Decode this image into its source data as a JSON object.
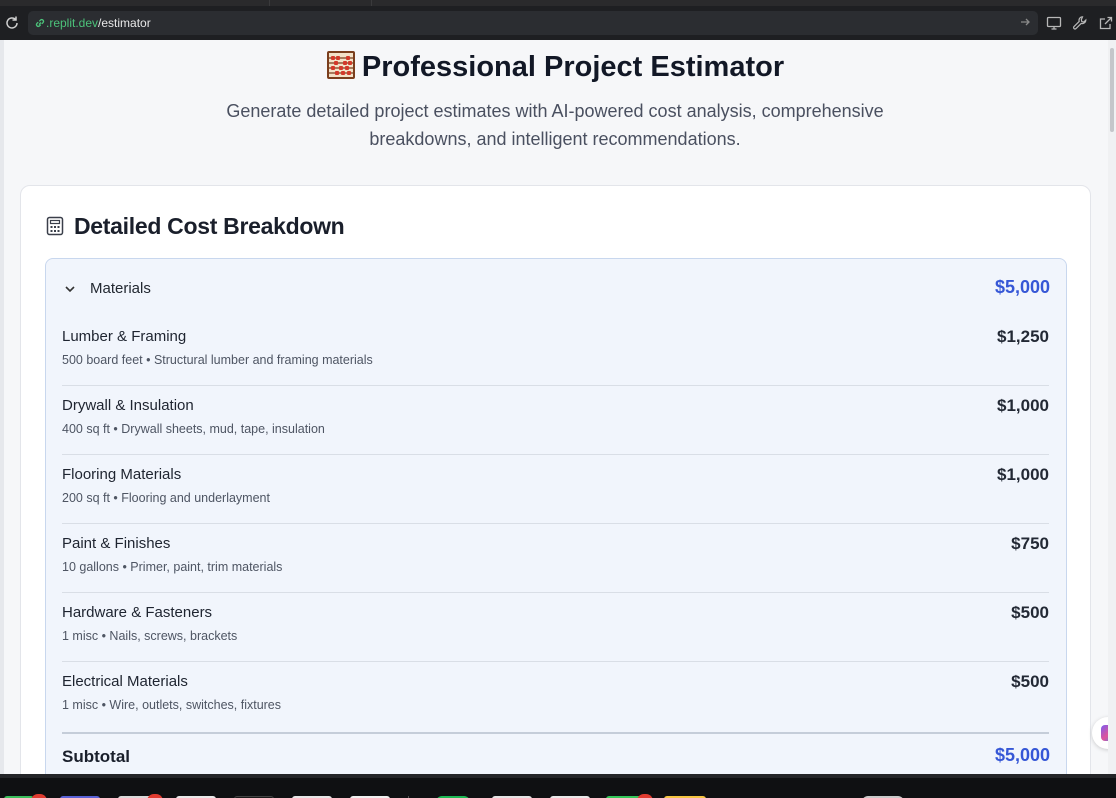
{
  "browser": {
    "url_domain": ".replit.dev",
    "url_path": "/estimator"
  },
  "page": {
    "title": "Professional Project Estimator",
    "subtitle": "Generate detailed project estimates with AI-powered cost analysis, comprehensive breakdowns, and intelligent recommendations."
  },
  "breakdown": {
    "title": "Detailed Cost Breakdown",
    "category": {
      "label": "Materials",
      "total": "$5,000",
      "items": [
        {
          "name": "Lumber & Framing",
          "desc": "500 board feet • Structural lumber and framing materials",
          "price": "$1,250"
        },
        {
          "name": "Drywall & Insulation",
          "desc": "400 sq ft • Drywall sheets, mud, tape, insulation",
          "price": "$1,000"
        },
        {
          "name": "Flooring Materials",
          "desc": "200 sq ft • Flooring and underlayment",
          "price": "$1,000"
        },
        {
          "name": "Paint & Finishes",
          "desc": "10 gallons • Primer, paint, trim materials",
          "price": "$750"
        },
        {
          "name": "Hardware & Fasteners",
          "desc": "1 misc • Nails, screws, brackets",
          "price": "$500"
        },
        {
          "name": "Electrical Materials",
          "desc": "1 misc • Wire, outlets, switches, fixtures",
          "price": "$500"
        }
      ],
      "subtotal_label": "Subtotal",
      "subtotal_value": "$5,000"
    }
  },
  "icons": {
    "reload": "reload-icon",
    "lock": "secure-link-icon",
    "go": "go-arrow-icon",
    "display": "display-icon",
    "wrench": "wrench-icon",
    "external": "open-external-icon",
    "title": "abacus-icon",
    "calculator": "calculator-icon",
    "chevron": "chevron-down-icon"
  },
  "colors": {
    "accent": "#3657d6",
    "category_bg": "#f1f5fc",
    "category_border": "#c8d7ee"
  }
}
